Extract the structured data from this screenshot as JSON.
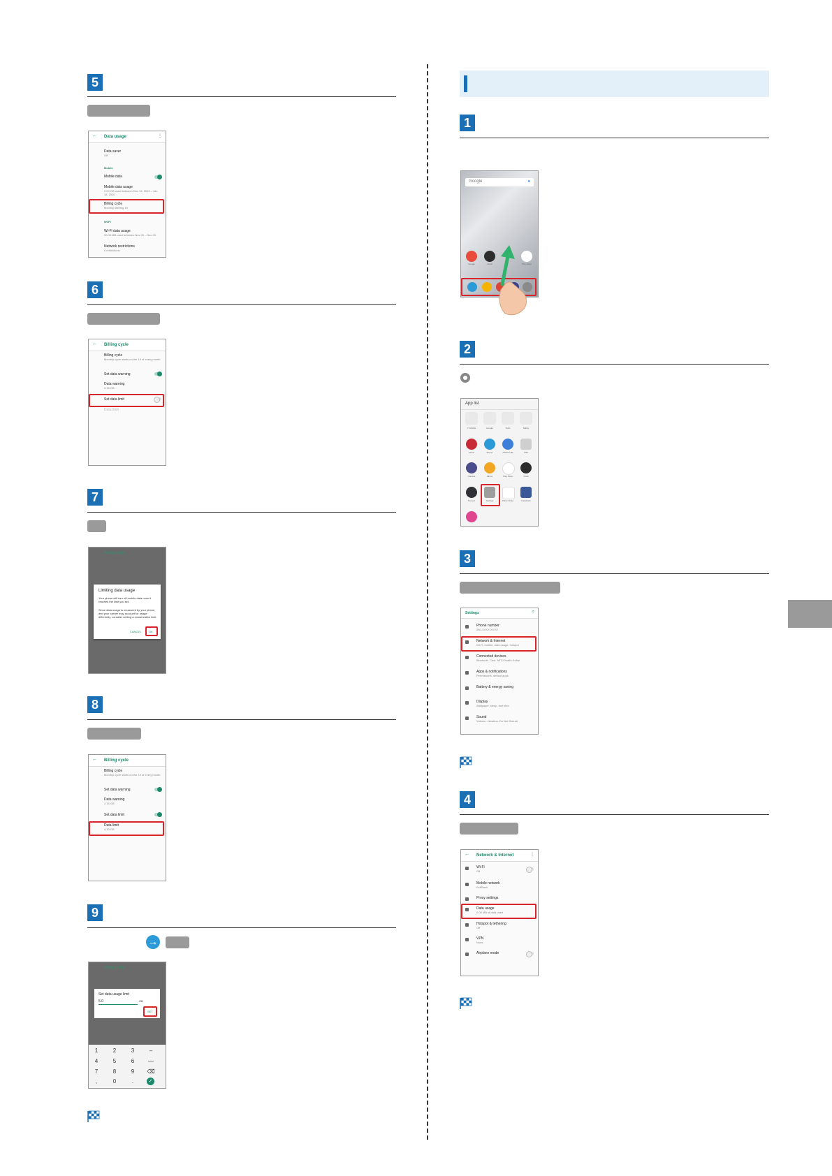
{
  "steps_left": [
    {
      "num": "5"
    },
    {
      "num": "6"
    },
    {
      "num": "7"
    },
    {
      "num": "8"
    },
    {
      "num": "9"
    }
  ],
  "steps_right": [
    {
      "num": "1"
    },
    {
      "num": "2"
    },
    {
      "num": "3"
    },
    {
      "num": "4"
    }
  ],
  "screen5": {
    "header": "Data usage",
    "data_saver_title": "Data saver",
    "data_saver_sub": "Off",
    "mobile_section": "Mobile",
    "mobile_data_title": "Mobile data",
    "mobile_usage_title": "Mobile data usage",
    "mobile_usage_sub": "0.00 GB used between Dec 19, 2019 – Jan 18, 2020",
    "billing_title": "Billing cycle",
    "billing_sub": "Monthly starting 19",
    "wifi_section": "Wi-Fi",
    "wifi_usage_title": "Wi-Fi data usage",
    "wifi_usage_sub": "20.00 MB used between Nov 26 – Dec 20",
    "restrictions_title": "Network restrictions",
    "restrictions_sub": "0 restrictions"
  },
  "screen6": {
    "header": "Billing cycle",
    "billing_title": "Billing cycle",
    "billing_sub": "Monthly cycle starts on the 19 of every month",
    "set_warning": "Set data warning",
    "warning_title": "Data warning",
    "warning_sub": "2.15 GB",
    "set_limit": "Set data limit",
    "limit_title": "Data limit"
  },
  "screen7": {
    "header": "Billing cycle",
    "dialog_title": "Limiting data usage",
    "dialog_p1": "Your phone will turn off mobile data once it reaches the limit you set.",
    "dialog_p2": "Since data usage is measured by your phone, and your carrier may account for usage differently, consider setting a conservative limit.",
    "cancel": "CANCEL",
    "ok": "OK"
  },
  "screen8": {
    "header": "Billing cycle",
    "billing_title": "Billing cycle",
    "billing_sub": "Monthly cycle starts on the 19 of every month",
    "set_warning": "Set data warning",
    "warning_title": "Data warning",
    "warning_sub": "2.15 GB",
    "set_limit": "Set data limit",
    "limit_title": "Data limit",
    "limit_sub": "4.30 GB"
  },
  "screen9": {
    "header": "Billing cycle",
    "dialog_title": "Set data usage limit",
    "input_value": "5.0",
    "unit": "GB",
    "set": "SET",
    "keys": [
      "1",
      "2",
      "3",
      "–",
      "4",
      "5",
      "6",
      "—",
      "7",
      "8",
      "9",
      "⌫",
      ",",
      "0",
      ".",
      "✓"
    ]
  },
  "home_screen": {
    "search_placeholder": "Google",
    "apps": [
      "Google",
      "Clock",
      "",
      "Play Store"
    ]
  },
  "app_list": {
    "title": "App list",
    "row1_labels": [
      "Y! Mobile",
      "Google",
      "Tools",
      "Safety"
    ],
    "row2_labels": [
      "Yahoo",
      "Phone",
      "Address Bk",
      "Mail"
    ],
    "row3_labels": [
      "Camera",
      "Album",
      "Play Store",
      "Clock"
    ],
    "row4_labels": [
      "Tool etc",
      "Settings",
      "Prime Video",
      "Facebook"
    ]
  },
  "settings_screen": {
    "header": "Settings",
    "items": [
      {
        "t": "Phone number",
        "s": "080-XXXX-XXXX"
      },
      {
        "t": "Network & Internet",
        "s": "Wi-Fi, mobile, data usage, hotspot"
      },
      {
        "t": "Connected devices",
        "s": "Bluetooth, Cast, NFC/Osaifu-Keitai"
      },
      {
        "t": "Apps & notifications",
        "s": "Permissions, default apps"
      },
      {
        "t": "Battery & energy saving",
        "s": ""
      },
      {
        "t": "Display",
        "s": "Wallpaper, sleep, font size"
      },
      {
        "t": "Sound",
        "s": "Volume, vibration, Do Not Disturb"
      }
    ]
  },
  "network_screen": {
    "header": "Network & Internet",
    "items": [
      {
        "t": "Wi-Fi",
        "s": "Off"
      },
      {
        "t": "Mobile network",
        "s": "SoftBank"
      },
      {
        "t": "Proxy settings",
        "s": ""
      },
      {
        "t": "Data usage",
        "s": "0.00 MB of data used"
      },
      {
        "t": "Hotspot & tethering",
        "s": "Off"
      },
      {
        "t": "VPN",
        "s": "None"
      },
      {
        "t": "Airplane mode",
        "s": ""
      }
    ]
  },
  "colors": {
    "step_blue": "#1a6fb5",
    "highlight_red": "#d8252b",
    "accent_green": "#1a8a6b",
    "band_blue": "#e3f0fa",
    "pill_gray": "#9a9a9a"
  }
}
